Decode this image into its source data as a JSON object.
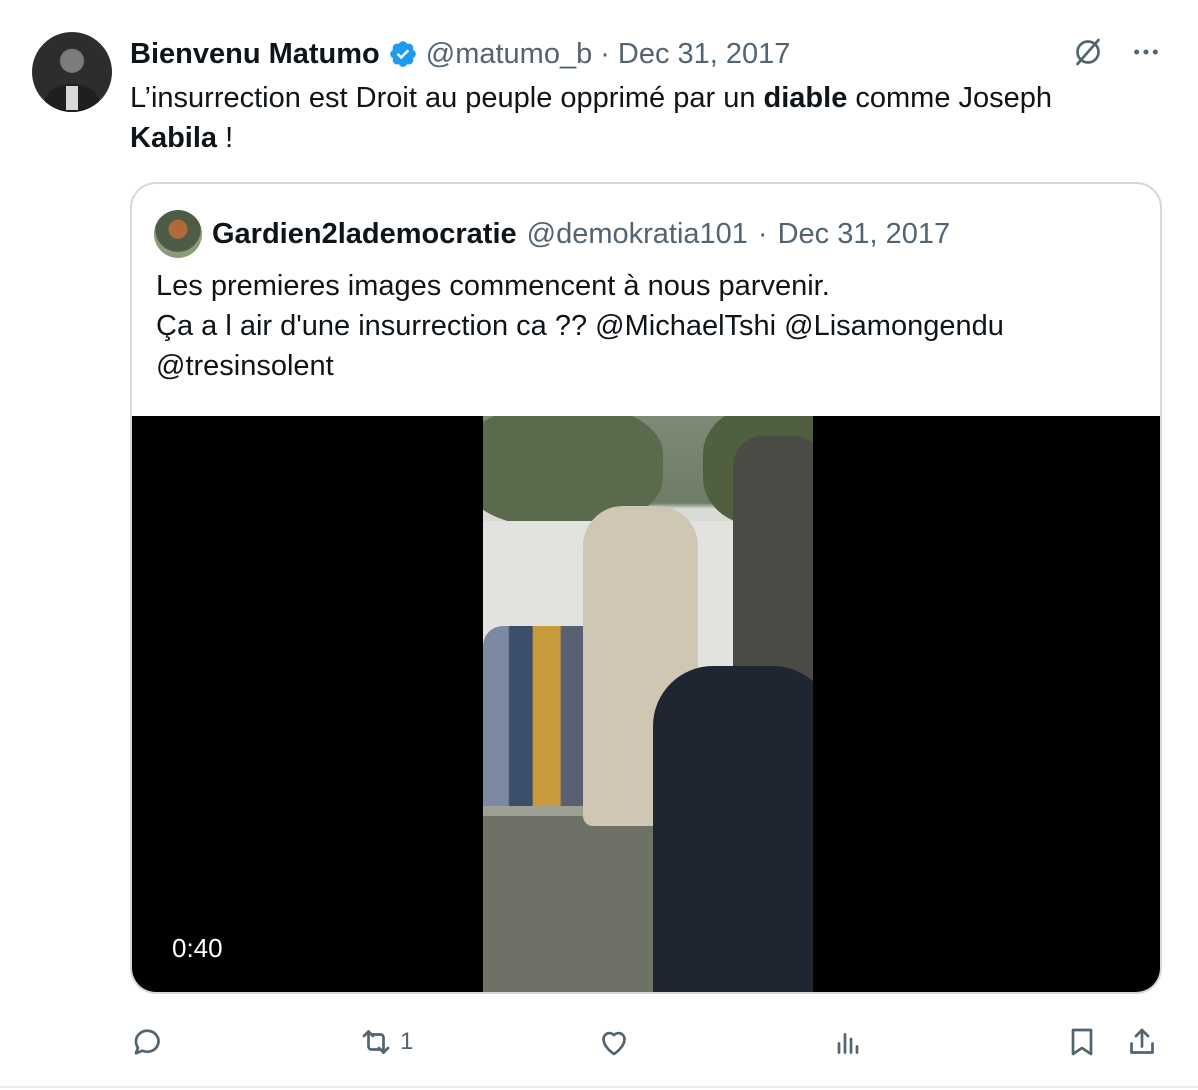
{
  "tweet": {
    "author_name": "Bienvenu Matumo",
    "handle": "@matumo_b",
    "separator": "·",
    "date": "Dec 31, 2017",
    "text_parts": [
      "L’insurrection est Droit au peuple opprimé par un ",
      "diable",
      " comme Joseph ",
      "Kabila",
      " !"
    ],
    "icons": {
      "verified": "verified-badge-icon",
      "grok": "grok-icon",
      "more": "more-icon"
    },
    "accent_color": "#1d9bf0"
  },
  "quoted_tweet": {
    "author_name": "Gardien2lademocratie",
    "handle": "@demokratia101",
    "separator": "·",
    "date": "Dec 31, 2017",
    "text_lines": [
      "Les premieres images commencent à nous parvenir.",
      "Ça a l air d'une insurrection ca ?? @MichaelTshi @Lisamongendu",
      "@tresinsolent"
    ],
    "video": {
      "duration": "0:40"
    }
  },
  "actions": {
    "reply": {
      "icon": "reply-icon",
      "count": ""
    },
    "retweet": {
      "icon": "retweet-icon",
      "count": "1"
    },
    "like": {
      "icon": "like-icon",
      "count": ""
    },
    "views": {
      "icon": "views-icon",
      "count": ""
    },
    "bookmark": {
      "icon": "bookmark-icon"
    },
    "share": {
      "icon": "share-icon"
    }
  }
}
